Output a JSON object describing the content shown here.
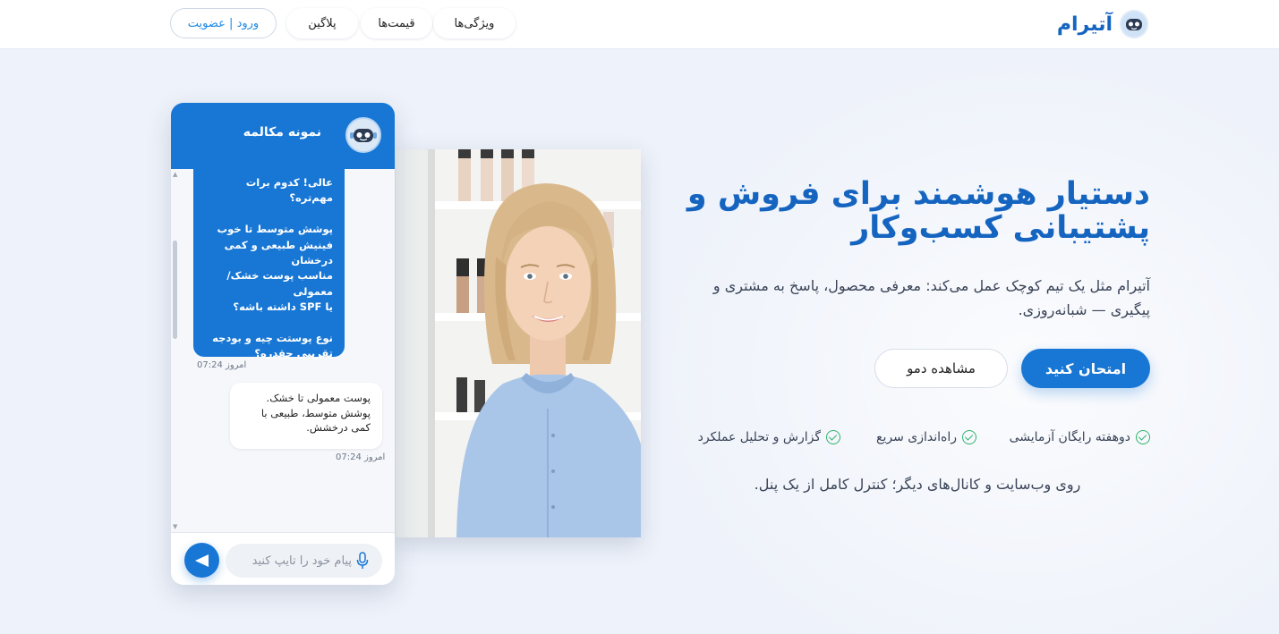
{
  "brand": {
    "name": "آتیرام",
    "logo_icon": "robot-face-icon"
  },
  "nav": {
    "features": "ویژگی‌ها",
    "prices": "قیمت‌ها",
    "plugin": "پلاگین",
    "login": "ورود | عضویت"
  },
  "hero": {
    "title": "دستیار هوشمند برای فروش و پشتیبانی کسب‌وکار",
    "subtitle": "آتیرام مثل یک تیم کوچک عمل می‌کند: معرفی محصول، پاسخ به مشتری و پیگیری — شبانه‌روزی.",
    "cta_primary": "امتحان کنید",
    "cta_secondary": "مشاهده دمو",
    "features": [
      "دوهفته رایگان آزمایشی",
      "راه‌اندازی سریع",
      "گزارش و تحلیل عملکرد"
    ],
    "channels": "روی وب‌سایت و کانال‌های دیگر؛ کنترل کامل از یک پنل."
  },
  "chat": {
    "title": "نمونه مکالمه",
    "messages": [
      {
        "from": "bot",
        "text": "عالی! کدوم برات مهم‌تره؟\n\nپوشش متوسط تا خوب\nفینیش طبیعی و کمی درخشان\nمناسب پوست خشک/معمولی\nیا SPF داشته باشه؟\n\nنوع پوستت چیه و بودجه تقریبی چقدره؟",
        "time": "امروز 07:24"
      },
      {
        "from": "user",
        "text": "پوست معمولی تا خشک.\nپوشش متوسط، طبیعی با کمی درخشش.",
        "time": "امروز 07:24"
      }
    ],
    "input_placeholder": "پیام خود را تایپ کنید",
    "send_icon": "send-icon",
    "mic_icon": "microphone-icon"
  },
  "colors": {
    "primary": "#1877d5",
    "brand_text": "#1565c0",
    "check": "#2fb36b",
    "background": "#eef2fa"
  }
}
